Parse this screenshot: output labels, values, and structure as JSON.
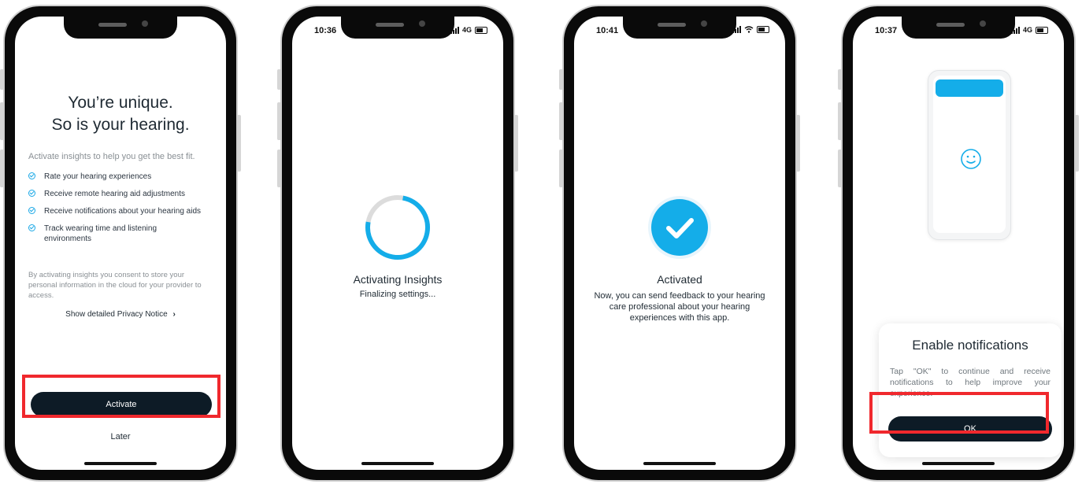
{
  "screen1": {
    "title_line1": "You’re unique.",
    "title_line2": "So is your hearing.",
    "intro": "Activate insights to help you get the best fit.",
    "checklist": [
      {
        "label": "Rate your hearing experiences"
      },
      {
        "label": "Receive remote hearing aid adjustments"
      },
      {
        "label": "Receive notifications about your hearing aids"
      },
      {
        "label": "Track wearing time and listening environments"
      }
    ],
    "consent": "By activating insights you consent to store your personal information in the cloud for your provider to access.",
    "privacy_link": "Show detailed Privacy Notice",
    "privacy_chevron": "›",
    "activate_label": "Activate",
    "later_label": "Later"
  },
  "screen2": {
    "time": "10:36",
    "network": "4G",
    "title": "Activating Insights",
    "subtitle": "Finalizing settings...",
    "progress_fraction": 0.75
  },
  "screen3": {
    "time": "10:41",
    "title": "Activated",
    "description": "Now, you can send feedback to your hearing care professional about your hearing experiences with this app."
  },
  "screen4": {
    "time": "10:37",
    "network": "4G",
    "dialog_title": "Enable notifications",
    "dialog_body": "Tap \"OK\" to continue and receive notifications to help improve your experience.",
    "ok_label": "OK"
  },
  "colors": {
    "accent": "#14ade9",
    "button_dark": "#0d1b26",
    "highlight": "#f0282d"
  },
  "icons": [
    "check-circle-icon",
    "chevron-right-icon",
    "spinner-icon",
    "checkmark-icon",
    "smiley-icon",
    "wifi-icon",
    "battery-icon",
    "signal-icon"
  ]
}
